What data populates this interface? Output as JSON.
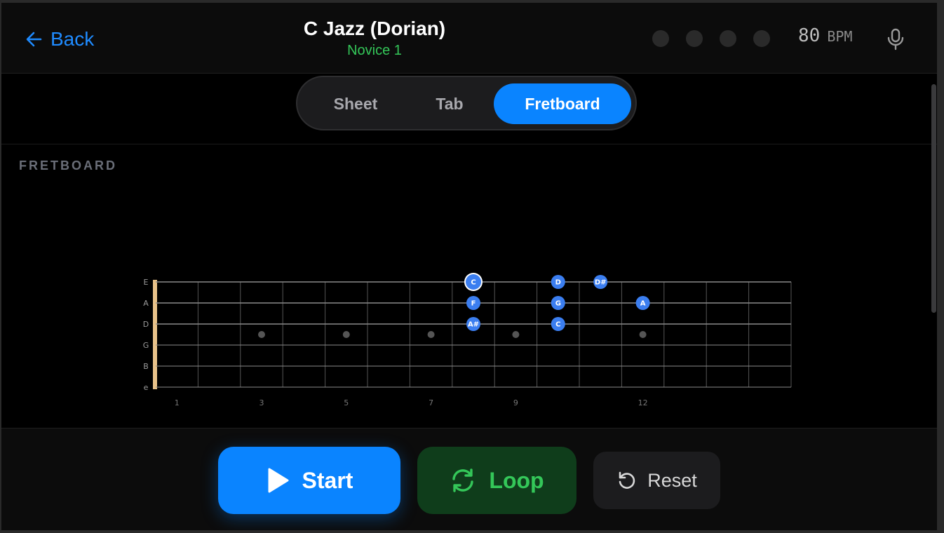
{
  "header": {
    "back_label": "Back",
    "title": "C Jazz (Dorian)",
    "subtitle": "Novice 1",
    "beat_dots": 4,
    "bpm_value": "80",
    "bpm_unit": "BPM"
  },
  "view_tabs": [
    {
      "label": "Sheet",
      "active": false
    },
    {
      "label": "Tab",
      "active": false
    },
    {
      "label": "Fretboard",
      "active": true
    }
  ],
  "section": {
    "label": "FRETBOARD"
  },
  "fretboard": {
    "strings": [
      "E",
      "A",
      "D",
      "G",
      "B",
      "e"
    ],
    "fret_count": 15,
    "fret_numbers": [
      "1",
      "3",
      "5",
      "7",
      "9",
      "12"
    ],
    "inlay_frets": [
      3,
      5,
      7,
      9,
      12
    ],
    "notes": [
      {
        "label": "C",
        "string": 0,
        "fret": 8,
        "current": true
      },
      {
        "label": "D",
        "string": 0,
        "fret": 10,
        "current": false
      },
      {
        "label": "D#",
        "string": 0,
        "fret": 11,
        "current": false
      },
      {
        "label": "F",
        "string": 1,
        "fret": 8,
        "current": false
      },
      {
        "label": "G",
        "string": 1,
        "fret": 10,
        "current": false
      },
      {
        "label": "A",
        "string": 1,
        "fret": 12,
        "current": false
      },
      {
        "label": "A#",
        "string": 2,
        "fret": 8,
        "current": false
      },
      {
        "label": "C",
        "string": 2,
        "fret": 10,
        "current": false
      }
    ]
  },
  "controls": {
    "start_label": "Start",
    "loop_label": "Loop",
    "reset_label": "Reset"
  },
  "colors": {
    "accent": "#0a84ff",
    "success": "#34c759",
    "note": "#3b7ef0",
    "nut": "#e8c28a"
  }
}
